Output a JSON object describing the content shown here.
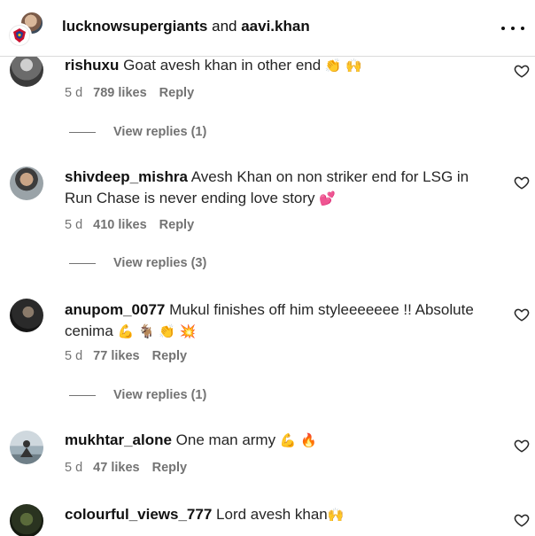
{
  "header": {
    "user1": "lucknowsupergiants",
    "conjunction": "and",
    "user2": "aavi.khan"
  },
  "comments": [
    {
      "username": "rishuxu",
      "text": "Goat avesh khan in other end ",
      "emoji": "👏 🙌",
      "time": "5 d",
      "likes": "789 likes",
      "reply": "Reply",
      "view_replies": "View replies (1)"
    },
    {
      "username": "shivdeep_mishra",
      "text": "Avesh Khan on non striker end for LSG in Run Chase is never ending love story ",
      "emoji": "💕",
      "time": "5 d",
      "likes": "410 likes",
      "reply": "Reply",
      "view_replies": "View replies (3)"
    },
    {
      "username": "anupom_0077",
      "text": "Mukul finishes off him styleeeeeee !! Absolute cenima ",
      "emoji": "💪 🐐 👏 💥",
      "time": "5 d",
      "likes": "77 likes",
      "reply": "Reply",
      "view_replies": "View replies (1)"
    },
    {
      "username": "mukhtar_alone",
      "text": "One man army ",
      "emoji": "💪 🔥",
      "time": "5 d",
      "likes": "47 likes",
      "reply": "Reply"
    },
    {
      "username": "colourful_views_777",
      "text": "Lord avesh khan",
      "emoji": "🙌"
    }
  ],
  "icons": {
    "more": "more-horizontal-icon",
    "like": "heart-icon"
  }
}
